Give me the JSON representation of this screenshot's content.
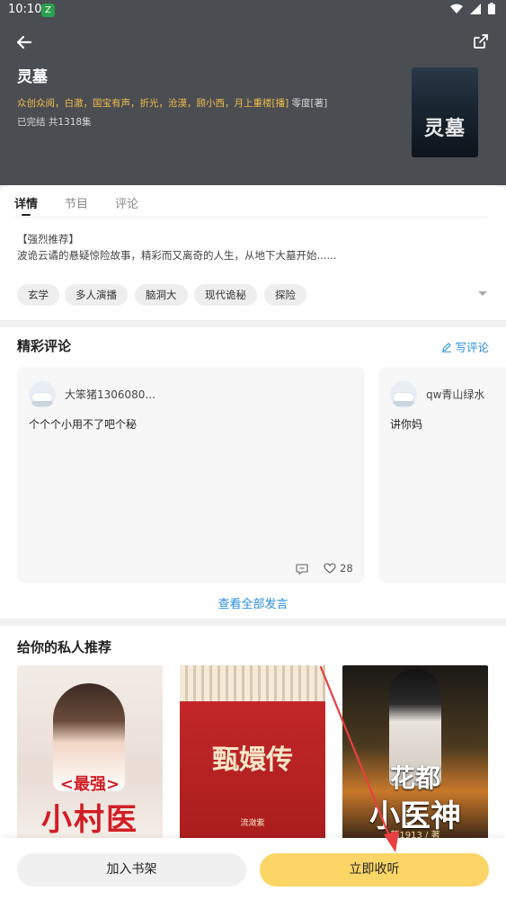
{
  "status_bar": {
    "time": "10:10",
    "app_badge": "Z"
  },
  "header": {
    "title": "灵墓",
    "cast": "众创众阅，白澈，国宝有声，折光，沧漠，顾小西，月上重楼[播]",
    "author": "零度[著]",
    "meta": "已完结  共1318集",
    "cover_title": "灵墓"
  },
  "tabs": [
    {
      "label": "详情",
      "active": true
    },
    {
      "label": "节目",
      "active": false
    },
    {
      "label": "评论",
      "active": false
    }
  ],
  "intro": {
    "line1": "【强烈推荐】",
    "line2": "波诡云谲的悬疑惊险故事，精彩而又离奇的人生，从地下大墓开始......"
  },
  "tags": [
    "玄学",
    "多人演播",
    "脑洞大",
    "现代诡秘",
    "探险"
  ],
  "comments": {
    "section_title": "精彩评论",
    "write_label": "写评论",
    "view_all": "查看全部发言",
    "items": [
      {
        "name": "大笨猪1306080...",
        "text": "个个个小用不了吧个秘",
        "likes": "28"
      },
      {
        "name": "qw青山绿水",
        "text": "讲你妈"
      }
    ]
  },
  "recommendations": {
    "section_title": "给你的私人推荐",
    "books": [
      {
        "title_top": "<最强>",
        "title_main": "小村医"
      },
      {
        "title_main": "甄嬛传",
        "subtitle": "流潋紫"
      },
      {
        "title_top": "花都",
        "title_main": "小医神",
        "subtitle": "朝1913 / 著"
      }
    ]
  },
  "actions": {
    "add_shelf": "加入书架",
    "listen_now": "立即收听"
  },
  "colors": {
    "header_bg": "#4a4d52",
    "cast_color": "#f3bd4b",
    "link_blue": "#2b8de0",
    "listen_button": "#fbd565",
    "annotation_arrow": "#e84040"
  }
}
